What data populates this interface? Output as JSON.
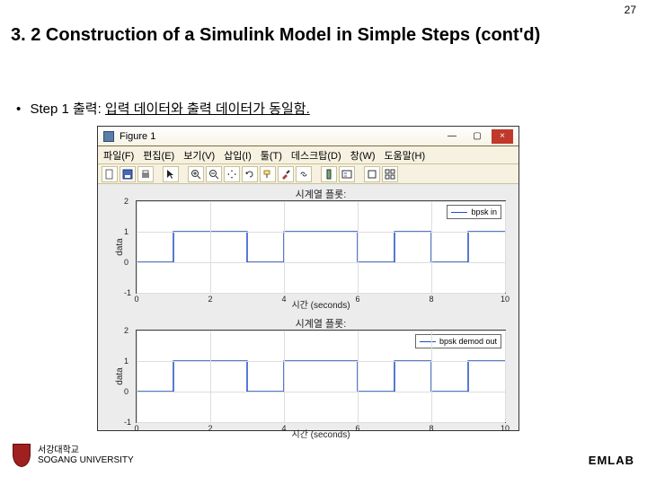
{
  "page_number": "27",
  "title": "3. 2 Construction of a Simulink Model in Simple Steps (cont'd)",
  "bullet": {
    "prefix": "Step 1 출력: ",
    "underlined": "입력 데이터와 출력 데이터가 동일함."
  },
  "figure_window": {
    "title": "Figure 1",
    "menus": [
      "파일(F)",
      "편집(E)",
      "보기(V)",
      "삽입(I)",
      "툴(T)",
      "데스크탑(D)",
      "창(W)",
      "도움말(H)"
    ],
    "winbuttons": {
      "min": "—",
      "max": "▢",
      "close": "×"
    }
  },
  "chart_data": [
    {
      "type": "line",
      "title": "시계열 플롯:",
      "xlabel": "시간 (seconds)",
      "ylabel": "data",
      "legend": "bpsk in",
      "xlim": [
        0,
        10
      ],
      "ylim": [
        -1,
        2
      ],
      "xticks": [
        0,
        2,
        4,
        6,
        8,
        10
      ],
      "yticks": [
        -1,
        0,
        1,
        2
      ],
      "x": [
        0,
        1,
        1.00001,
        3,
        3.00001,
        4,
        4.00001,
        6,
        6.00001,
        7,
        7.00001,
        8,
        8.00001,
        9,
        9.00001,
        10
      ],
      "y": [
        0,
        0,
        1,
        1,
        0,
        0,
        1,
        1,
        0,
        0,
        1,
        1,
        0,
        0,
        1,
        1
      ]
    },
    {
      "type": "line",
      "title": "시계열 플롯:",
      "xlabel": "시간 (seconds)",
      "ylabel": "data",
      "legend": "bpsk demod out",
      "xlim": [
        0,
        10
      ],
      "ylim": [
        -1,
        2
      ],
      "xticks": [
        0,
        2,
        4,
        6,
        8,
        10
      ],
      "yticks": [
        -1,
        0,
        1,
        2
      ],
      "x": [
        0,
        1,
        1.00001,
        3,
        3.00001,
        4,
        4.00001,
        6,
        6.00001,
        7,
        7.00001,
        8,
        8.00001,
        9,
        9.00001,
        10
      ],
      "y": [
        0,
        0,
        1,
        1,
        0,
        0,
        1,
        1,
        0,
        0,
        1,
        1,
        0,
        0,
        1,
        1
      ]
    }
  ],
  "footer": {
    "university_kr": "서강대학교",
    "university_en": "SOGANG UNIVERSITY",
    "lab": "EMLAB"
  }
}
